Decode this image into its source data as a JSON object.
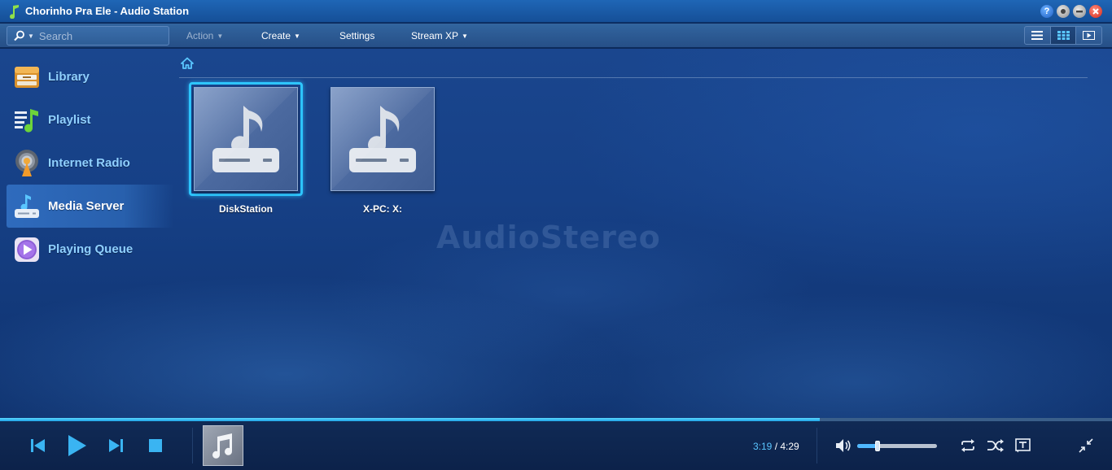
{
  "window": {
    "title": "Chorinho Pra Ele - Audio Station",
    "controls": [
      "help",
      "options",
      "minimize",
      "close"
    ]
  },
  "toolbar": {
    "search_placeholder": "Search",
    "action_label": "Action",
    "create_label": "Create",
    "settings_label": "Settings",
    "stream_label": "Stream XP",
    "view_modes": [
      "list-view",
      "thumbnail-view",
      "cover-flow-view"
    ],
    "active_view": "thumbnail-view"
  },
  "sidebar": {
    "items": [
      {
        "label": "Library",
        "icon": "library-icon"
      },
      {
        "label": "Playlist",
        "icon": "playlist-icon"
      },
      {
        "label": "Internet Radio",
        "icon": "internet-radio-icon"
      },
      {
        "label": "Media Server",
        "icon": "media-server-icon",
        "active": true
      },
      {
        "label": "Playing Queue",
        "icon": "playing-queue-icon"
      }
    ]
  },
  "content": {
    "breadcrumb_icon": "home-icon",
    "tiles": [
      {
        "label": "DiskStation",
        "icon": "media-server-icon",
        "selected": true
      },
      {
        "label": "X-PC: X:",
        "icon": "media-server-icon",
        "selected": false
      }
    ],
    "watermark": "AudioStereo"
  },
  "player": {
    "progress_fraction": 0.737,
    "current_time": "3:19",
    "separator": " / ",
    "total_time": "4:29",
    "volume_fraction": 0.26,
    "accent_color": "#2ec6ff"
  }
}
